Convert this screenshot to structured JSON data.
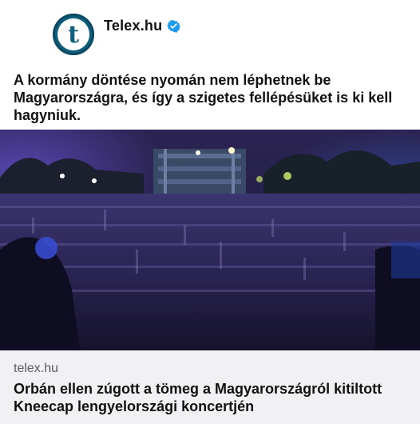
{
  "post": {
    "account_name": "Telex.hu",
    "avatar_letter": "t",
    "verified_icon": "verified-badge-icon",
    "text": "A kormány döntése nyomán nem léphetnek be Magyarországra, és így a szigetes fellépésüket is ki kell hagyniuk."
  },
  "media": {
    "description_icon": "concert-crowd-image"
  },
  "link_preview": {
    "domain": "telex.hu",
    "title": "Orbán ellen zúgott a tömeg a Magyarországról kitiltott Kneecap lengyelországi koncertjén"
  },
  "colors": {
    "brand": "#0f5e7c",
    "verified": "#1d9bf0",
    "card_background": "#f1f1f3"
  }
}
